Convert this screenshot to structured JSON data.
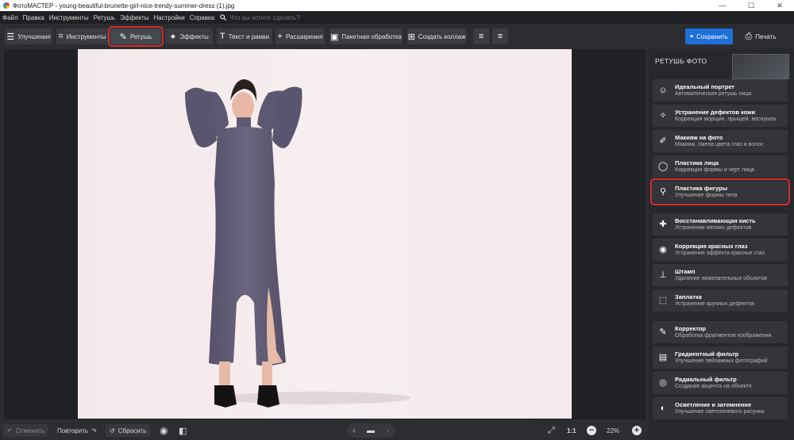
{
  "window": {
    "title": "ФотоМАСТЕР - young-beautiful-brunette-girl-nice-trendy-summer-dress (1).jpg",
    "buttons": [
      "—",
      "☐",
      "✕"
    ]
  },
  "menu": {
    "items": [
      "Файл",
      "Правка",
      "Инструменты",
      "Ретушь",
      "Эффекты",
      "Настройки",
      "Справка"
    ],
    "search_placeholder": "Что вы хотите сделать?"
  },
  "toolbar": {
    "improvements": "Улучшения",
    "tools": "Инструменты",
    "retouch": "Ретушь",
    "effects": "Эффекты",
    "text_frames": "Текст и рамки",
    "extensions": "Расширения",
    "batch": "Пакетная обработка",
    "collage": "Создать коллаж",
    "save": "Сохранить",
    "print": "Печать"
  },
  "panel": {
    "title": "РЕТУШЬ ФОТО",
    "items": [
      {
        "title": "Идеальный портрет",
        "subtitle": "Автоматическая ретушь лица",
        "icon": "face-icon"
      },
      {
        "title": "Устранение дефектов кожи",
        "subtitle": "Коррекция морщин, прыщей, веснушек",
        "icon": "skin-icon"
      },
      {
        "title": "Макияж на фото",
        "subtitle": "Макияж, смена цвета глаз и волос",
        "icon": "makeup-icon"
      },
      {
        "title": "Пластика лица",
        "subtitle": "Коррекция формы и черт лица",
        "icon": "face-shape-icon"
      },
      {
        "title": "Пластика фигуры",
        "subtitle": "Улучшение формы тела",
        "icon": "body-shape-icon"
      },
      {
        "title": "Восстанавливающая кисть",
        "subtitle": "Устранение мелких дефектов",
        "icon": "healing-brush-icon"
      },
      {
        "title": "Коррекция красных глаз",
        "subtitle": "Устранение эффекта красных глаз",
        "icon": "eye-icon"
      },
      {
        "title": "Штамп",
        "subtitle": "Удаление нежелательных объектов",
        "icon": "stamp-icon"
      },
      {
        "title": "Заплатка",
        "subtitle": "Устранение крупных дефектов",
        "icon": "patch-icon"
      },
      {
        "title": "Корректор",
        "subtitle": "Обработка фрагментов изображения",
        "icon": "brush-icon"
      },
      {
        "title": "Градиентный фильтр",
        "subtitle": "Улучшение пейзажных фотографий",
        "icon": "gradient-icon"
      },
      {
        "title": "Радиальный фильтр",
        "subtitle": "Создание акцента на объекте",
        "icon": "radial-icon"
      },
      {
        "title": "Осветление и затемнение",
        "subtitle": "Улучшение светотеневого рисунка",
        "icon": "dodge-burn-icon"
      }
    ]
  },
  "status": {
    "undo": "Отменить",
    "redo": "Повторить",
    "reset": "Сбросить",
    "ratio": "1:1",
    "zoom": "22%"
  }
}
